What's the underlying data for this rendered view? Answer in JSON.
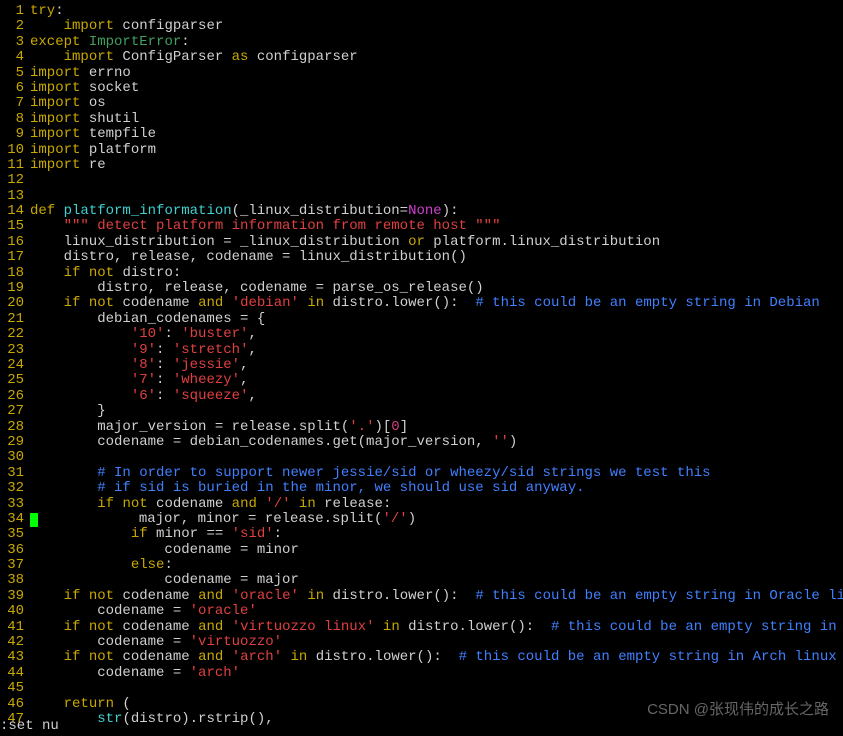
{
  "status_bar": ":set nu",
  "watermark": "CSDN @张现伟的成长之路",
  "cursor_line": 34,
  "lines": [
    {
      "n": 1,
      "tokens": [
        [
          "kw",
          "try"
        ],
        [
          "pl",
          ":"
        ]
      ]
    },
    {
      "n": 2,
      "tokens": [
        [
          "pl",
          "    "
        ],
        [
          "kw",
          "import"
        ],
        [
          "pl",
          " configparser"
        ]
      ]
    },
    {
      "n": 3,
      "tokens": [
        [
          "kw",
          "except"
        ],
        [
          "pl",
          " "
        ],
        [
          "imp",
          "ImportError"
        ],
        [
          "pl",
          ":"
        ]
      ]
    },
    {
      "n": 4,
      "tokens": [
        [
          "pl",
          "    "
        ],
        [
          "kw",
          "import"
        ],
        [
          "pl",
          " ConfigParser "
        ],
        [
          "kw",
          "as"
        ],
        [
          "pl",
          " configparser"
        ]
      ]
    },
    {
      "n": 5,
      "tokens": [
        [
          "kw",
          "import"
        ],
        [
          "pl",
          " errno"
        ]
      ]
    },
    {
      "n": 6,
      "tokens": [
        [
          "kw",
          "import"
        ],
        [
          "pl",
          " socket"
        ]
      ]
    },
    {
      "n": 7,
      "tokens": [
        [
          "kw",
          "import"
        ],
        [
          "pl",
          " os"
        ]
      ]
    },
    {
      "n": 8,
      "tokens": [
        [
          "kw",
          "import"
        ],
        [
          "pl",
          " shutil"
        ]
      ]
    },
    {
      "n": 9,
      "tokens": [
        [
          "kw",
          "import"
        ],
        [
          "pl",
          " tempfile"
        ]
      ]
    },
    {
      "n": 10,
      "tokens": [
        [
          "kw",
          "import"
        ],
        [
          "pl",
          " platform"
        ]
      ]
    },
    {
      "n": 11,
      "tokens": [
        [
          "kw",
          "import"
        ],
        [
          "pl",
          " re"
        ]
      ]
    },
    {
      "n": 12,
      "tokens": []
    },
    {
      "n": 13,
      "tokens": []
    },
    {
      "n": 14,
      "tokens": [
        [
          "kw",
          "def"
        ],
        [
          "pl",
          " "
        ],
        [
          "fn",
          "platform_information"
        ],
        [
          "pl",
          "(_linux_distribution="
        ],
        [
          "bi",
          "None"
        ],
        [
          "pl",
          "):"
        ]
      ]
    },
    {
      "n": 15,
      "tokens": [
        [
          "pl",
          "    "
        ],
        [
          "st",
          "\"\"\" detect platform information from remote host \"\"\""
        ]
      ]
    },
    {
      "n": 16,
      "tokens": [
        [
          "pl",
          "    linux_distribution = _linux_distribution "
        ],
        [
          "kw",
          "or"
        ],
        [
          "pl",
          " platform.linux_distribution"
        ]
      ]
    },
    {
      "n": 17,
      "tokens": [
        [
          "pl",
          "    distro, release, codename = linux_distribution()"
        ]
      ]
    },
    {
      "n": 18,
      "tokens": [
        [
          "pl",
          "    "
        ],
        [
          "kw",
          "if"
        ],
        [
          "pl",
          " "
        ],
        [
          "kw",
          "not"
        ],
        [
          "pl",
          " distro:"
        ]
      ]
    },
    {
      "n": 19,
      "tokens": [
        [
          "pl",
          "        distro, release, codename = parse_os_release()"
        ]
      ]
    },
    {
      "n": 20,
      "tokens": [
        [
          "pl",
          "    "
        ],
        [
          "kw",
          "if"
        ],
        [
          "pl",
          " "
        ],
        [
          "kw",
          "not"
        ],
        [
          "pl",
          " codename "
        ],
        [
          "kw",
          "and"
        ],
        [
          "pl",
          " "
        ],
        [
          "st",
          "'debian'"
        ],
        [
          "pl",
          " "
        ],
        [
          "kw",
          "in"
        ],
        [
          "pl",
          " distro.lower():  "
        ],
        [
          "cm",
          "# this could be an empty string in Debian"
        ]
      ]
    },
    {
      "n": 21,
      "tokens": [
        [
          "pl",
          "        debian_codenames = {"
        ]
      ]
    },
    {
      "n": 22,
      "tokens": [
        [
          "pl",
          "            "
        ],
        [
          "st",
          "'10'"
        ],
        [
          "pl",
          ": "
        ],
        [
          "st",
          "'buster'"
        ],
        [
          "pl",
          ","
        ]
      ]
    },
    {
      "n": 23,
      "tokens": [
        [
          "pl",
          "            "
        ],
        [
          "st",
          "'9'"
        ],
        [
          "pl",
          ": "
        ],
        [
          "st",
          "'stretch'"
        ],
        [
          "pl",
          ","
        ]
      ]
    },
    {
      "n": 24,
      "tokens": [
        [
          "pl",
          "            "
        ],
        [
          "st",
          "'8'"
        ],
        [
          "pl",
          ": "
        ],
        [
          "st",
          "'jessie'"
        ],
        [
          "pl",
          ","
        ]
      ]
    },
    {
      "n": 25,
      "tokens": [
        [
          "pl",
          "            "
        ],
        [
          "st",
          "'7'"
        ],
        [
          "pl",
          ": "
        ],
        [
          "st",
          "'wheezy'"
        ],
        [
          "pl",
          ","
        ]
      ]
    },
    {
      "n": 26,
      "tokens": [
        [
          "pl",
          "            "
        ],
        [
          "st",
          "'6'"
        ],
        [
          "pl",
          ": "
        ],
        [
          "st",
          "'squeeze'"
        ],
        [
          "pl",
          ","
        ]
      ]
    },
    {
      "n": 27,
      "tokens": [
        [
          "pl",
          "        }"
        ]
      ]
    },
    {
      "n": 28,
      "tokens": [
        [
          "pl",
          "        major_version = release.split("
        ],
        [
          "st",
          "'.'"
        ],
        [
          "pl",
          ")["
        ],
        [
          "nm",
          "0"
        ],
        [
          "pl",
          "]"
        ]
      ]
    },
    {
      "n": 29,
      "tokens": [
        [
          "pl",
          "        codename = debian_codenames.get(major_version, "
        ],
        [
          "st",
          "''"
        ],
        [
          "pl",
          ")"
        ]
      ]
    },
    {
      "n": 30,
      "tokens": []
    },
    {
      "n": 31,
      "tokens": [
        [
          "pl",
          "        "
        ],
        [
          "cm",
          "# In order to support newer jessie/sid or wheezy/sid strings we test this"
        ]
      ]
    },
    {
      "n": 32,
      "tokens": [
        [
          "pl",
          "        "
        ],
        [
          "cm",
          "# if sid is buried in the minor, we should use sid anyway."
        ]
      ]
    },
    {
      "n": 33,
      "tokens": [
        [
          "pl",
          "        "
        ],
        [
          "kw",
          "if"
        ],
        [
          "pl",
          " "
        ],
        [
          "kw",
          "not"
        ],
        [
          "pl",
          " codename "
        ],
        [
          "kw",
          "and"
        ],
        [
          "pl",
          " "
        ],
        [
          "st",
          "'/'"
        ],
        [
          "pl",
          " "
        ],
        [
          "kw",
          "in"
        ],
        [
          "pl",
          " release:"
        ]
      ]
    },
    {
      "n": 34,
      "tokens": [
        [
          "pl",
          "            major, minor = release.split("
        ],
        [
          "st",
          "'/'"
        ],
        [
          "pl",
          ")"
        ]
      ]
    },
    {
      "n": 35,
      "tokens": [
        [
          "pl",
          "            "
        ],
        [
          "kw",
          "if"
        ],
        [
          "pl",
          " minor == "
        ],
        [
          "st",
          "'sid'"
        ],
        [
          "pl",
          ":"
        ]
      ]
    },
    {
      "n": 36,
      "tokens": [
        [
          "pl",
          "                codename = minor"
        ]
      ]
    },
    {
      "n": 37,
      "tokens": [
        [
          "pl",
          "            "
        ],
        [
          "kw",
          "else"
        ],
        [
          "pl",
          ":"
        ]
      ]
    },
    {
      "n": 38,
      "tokens": [
        [
          "pl",
          "                codename = major"
        ]
      ]
    },
    {
      "n": 39,
      "tokens": [
        [
          "pl",
          "    "
        ],
        [
          "kw",
          "if"
        ],
        [
          "pl",
          " "
        ],
        [
          "kw",
          "not"
        ],
        [
          "pl",
          " codename "
        ],
        [
          "kw",
          "and"
        ],
        [
          "pl",
          " "
        ],
        [
          "st",
          "'oracle'"
        ],
        [
          "pl",
          " "
        ],
        [
          "kw",
          "in"
        ],
        [
          "pl",
          " distro.lower():  "
        ],
        [
          "cm",
          "# this could be an empty string in Oracle linux"
        ]
      ]
    },
    {
      "n": 40,
      "tokens": [
        [
          "pl",
          "        codename = "
        ],
        [
          "st",
          "'oracle'"
        ]
      ]
    },
    {
      "n": 41,
      "tokens": [
        [
          "pl",
          "    "
        ],
        [
          "kw",
          "if"
        ],
        [
          "pl",
          " "
        ],
        [
          "kw",
          "not"
        ],
        [
          "pl",
          " codename "
        ],
        [
          "kw",
          "and"
        ],
        [
          "pl",
          " "
        ],
        [
          "st",
          "'virtuozzo linux'"
        ],
        [
          "pl",
          " "
        ],
        [
          "kw",
          "in"
        ],
        [
          "pl",
          " distro.lower():  "
        ],
        [
          "cm",
          "# this could be an empty string in Virtuozzo linux"
        ]
      ]
    },
    {
      "n": 42,
      "tokens": [
        [
          "pl",
          "        codename = "
        ],
        [
          "st",
          "'virtuozzo'"
        ]
      ]
    },
    {
      "n": 43,
      "tokens": [
        [
          "pl",
          "    "
        ],
        [
          "kw",
          "if"
        ],
        [
          "pl",
          " "
        ],
        [
          "kw",
          "not"
        ],
        [
          "pl",
          " codename "
        ],
        [
          "kw",
          "and"
        ],
        [
          "pl",
          " "
        ],
        [
          "st",
          "'arch'"
        ],
        [
          "pl",
          " "
        ],
        [
          "kw",
          "in"
        ],
        [
          "pl",
          " distro.lower():  "
        ],
        [
          "cm",
          "# this could be an empty string in Arch linux"
        ]
      ]
    },
    {
      "n": 44,
      "tokens": [
        [
          "pl",
          "        codename = "
        ],
        [
          "st",
          "'arch'"
        ]
      ]
    },
    {
      "n": 45,
      "tokens": []
    },
    {
      "n": 46,
      "tokens": [
        [
          "pl",
          "    "
        ],
        [
          "kw",
          "return"
        ],
        [
          "pl",
          " ("
        ]
      ]
    },
    {
      "n": 47,
      "tokens": [
        [
          "pl",
          "        "
        ],
        [
          "fn",
          "str"
        ],
        [
          "pl",
          "(distro).rstrip(),"
        ]
      ]
    }
  ]
}
